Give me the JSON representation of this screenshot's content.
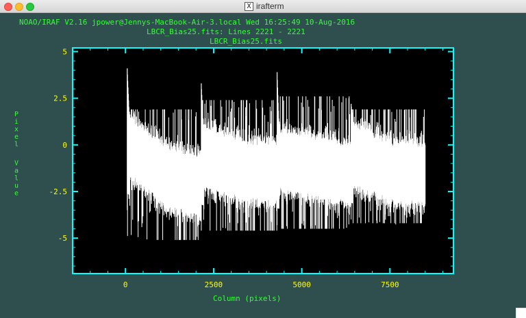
{
  "window": {
    "title": "irafterm",
    "x_icon": "x-window-icon"
  },
  "plot": {
    "header_line": "NOAO/IRAF V2.16 jpower@Jennys-MacBook-Air-3.local Wed 16:25:49 10-Aug-2016",
    "subheader_line": "LBCR_Bias25.fits: Lines 2221 - 2221",
    "title": "LBCR_Bias25.fits",
    "colors": {
      "background": "#2f4f4f",
      "plot_area": "#000000",
      "axes": "#00ffff",
      "text": "#33ff33",
      "tick_labels": "#ffff00",
      "data": "#ffffff"
    }
  },
  "chart_data": {
    "type": "line",
    "title": "LBCR_Bias25.fits",
    "xlabel": "Column (pixels)",
    "ylabel": "Pixel Value",
    "xlim": [
      -1500,
      9300
    ],
    "ylim": [
      -6.9,
      5.2
    ],
    "x_ticks": [
      0,
      2500,
      5000,
      7500
    ],
    "x_tick_labels": [
      "0",
      "2500",
      "5000",
      "7500"
    ],
    "y_ticks": [
      5,
      2.5,
      0,
      -2.5,
      -5
    ],
    "y_tick_labels": [
      "5",
      "2.5",
      "0",
      "-2.5",
      "-5"
    ],
    "grid": false,
    "segments": [
      {
        "x_start": 50,
        "x_end": 2150,
        "start_peak": 4.1,
        "start_mean": 0.0,
        "mid_mean": -1.8,
        "end_mean": -2.2,
        "low": -5.1,
        "high": 1.9
      },
      {
        "x_start": 2150,
        "x_end": 4300,
        "start_peak": 3.3,
        "start_mean": -0.6,
        "mid_mean": -1.4,
        "end_mean": -1.5,
        "low": -4.6,
        "high": 2.4
      },
      {
        "x_start": 4300,
        "x_end": 6400,
        "start_peak": 3.9,
        "start_mean": -0.8,
        "mid_mean": -1.2,
        "end_mean": -1.6,
        "low": -4.5,
        "high": 2.6
      },
      {
        "x_start": 6400,
        "x_end": 8500,
        "start_peak": 2.2,
        "start_mean": -0.5,
        "mid_mean": -1.5,
        "end_mean": -1.6,
        "low": -4.2,
        "high": 1.9
      }
    ]
  }
}
